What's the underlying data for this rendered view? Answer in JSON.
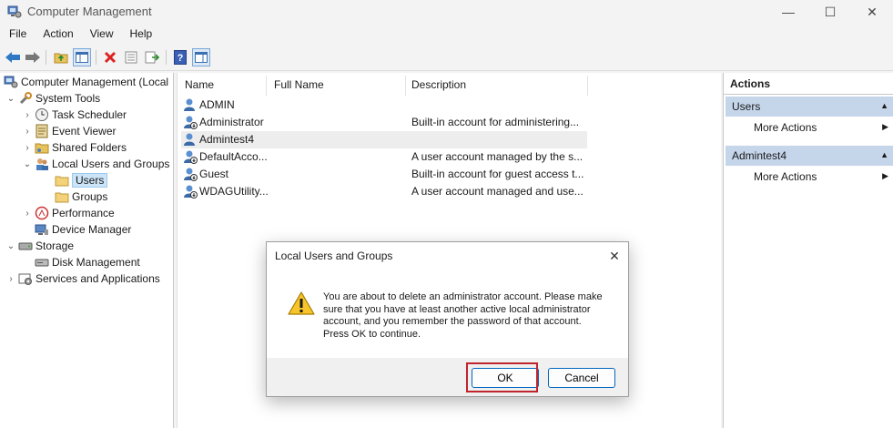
{
  "window": {
    "title": "Computer Management"
  },
  "menu": [
    "File",
    "Action",
    "View",
    "Help"
  ],
  "tree": [
    {
      "label": "Computer Management (Local",
      "name": "tree-computer-management"
    },
    {
      "label": "System Tools",
      "name": "tree-system-tools"
    },
    {
      "label": "Task Scheduler",
      "name": "tree-task-scheduler"
    },
    {
      "label": "Event Viewer",
      "name": "tree-event-viewer"
    },
    {
      "label": "Shared Folders",
      "name": "tree-shared-folders"
    },
    {
      "label": "Local Users and Groups",
      "name": "tree-local-users-groups"
    },
    {
      "label": "Users",
      "name": "tree-users"
    },
    {
      "label": "Groups",
      "name": "tree-groups"
    },
    {
      "label": "Performance",
      "name": "tree-performance"
    },
    {
      "label": "Device Manager",
      "name": "tree-device-manager"
    },
    {
      "label": "Storage",
      "name": "tree-storage"
    },
    {
      "label": "Disk Management",
      "name": "tree-disk-management"
    },
    {
      "label": "Services and Applications",
      "name": "tree-services-applications"
    }
  ],
  "list": {
    "columns": [
      "Name",
      "Full Name",
      "Description"
    ],
    "rows": [
      {
        "name": "ADMIN",
        "full_name": "",
        "description": ""
      },
      {
        "name": "Administrator",
        "full_name": "",
        "description": "Built-in account for administering..."
      },
      {
        "name": "Admintest4",
        "full_name": "",
        "description": ""
      },
      {
        "name": "DefaultAcco...",
        "full_name": "",
        "description": "A user account managed by the s..."
      },
      {
        "name": "Guest",
        "full_name": "",
        "description": "Built-in account for guest access t..."
      },
      {
        "name": "WDAGUtility...",
        "full_name": "",
        "description": "A user account managed and use..."
      }
    ]
  },
  "actions": {
    "title": "Actions",
    "sections": [
      {
        "label": "Users",
        "item": "More Actions"
      },
      {
        "label": "Admintest4",
        "item": "More Actions"
      }
    ]
  },
  "dialog": {
    "title": "Local Users and Groups",
    "message": "You are about to delete an administrator account. Please make sure that you have at least another active local administrator account, and you remember the password of that account. Press OK to continue.",
    "ok_label": "OK",
    "cancel_label": "Cancel"
  },
  "colors": {
    "selection": "#cce4f7",
    "action_section": "#c5d5ea",
    "highlight_box": "#c0252e",
    "button_accent": "#0067c0"
  }
}
